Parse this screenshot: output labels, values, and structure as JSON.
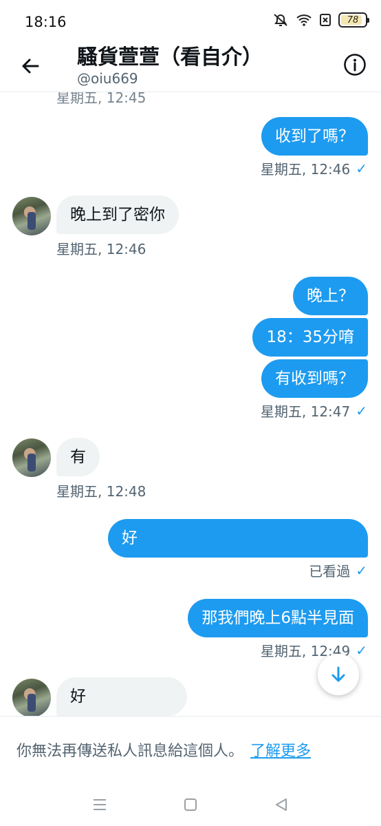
{
  "status_bar": {
    "time": "18:16",
    "battery": "78",
    "icons": [
      "mute-icon",
      "wifi-icon",
      "sim-off-icon",
      "battery-icon"
    ]
  },
  "header": {
    "back_icon": "arrow-left-icon",
    "title": "騷貨萱萱（看自介）",
    "handle": "@oiu669",
    "info_icon": "info-icon"
  },
  "messages": [
    {
      "dir": "out",
      "text": "收到了嗎？"
    },
    {
      "dir": "out_ts",
      "text": "星期五, 12:46"
    },
    {
      "dir": "in",
      "text": "晚上到了密你"
    },
    {
      "dir": "in_ts",
      "text": "星期五, 12:46"
    },
    {
      "dir": "out",
      "text": "晚上？"
    },
    {
      "dir": "out",
      "text": "18：35分唷"
    },
    {
      "dir": "out",
      "text": "有收到嗎？"
    },
    {
      "dir": "out_ts",
      "text": "星期五, 12:47"
    },
    {
      "dir": "in",
      "text": "有"
    },
    {
      "dir": "in_ts",
      "text": "星期五, 12:48"
    },
    {
      "dir": "out",
      "text": "好"
    },
    {
      "dir": "out_ts",
      "text": "已看過"
    },
    {
      "dir": "out",
      "text": "那我們晚上6點半見面"
    },
    {
      "dir": "out_ts",
      "text": "星期五, 12:49"
    },
    {
      "dir": "in",
      "text": "好"
    }
  ],
  "footer": {
    "notice": "你無法再傳送私人訊息給這個人。",
    "learn_more": "了解更多"
  },
  "nav": {
    "icons": [
      "recents-icon",
      "home-icon",
      "back-triangle-icon"
    ]
  },
  "colors": {
    "accent": "#1d9bf0",
    "incoming_bubble": "#eff3f4",
    "secondary_text": "#536471"
  }
}
